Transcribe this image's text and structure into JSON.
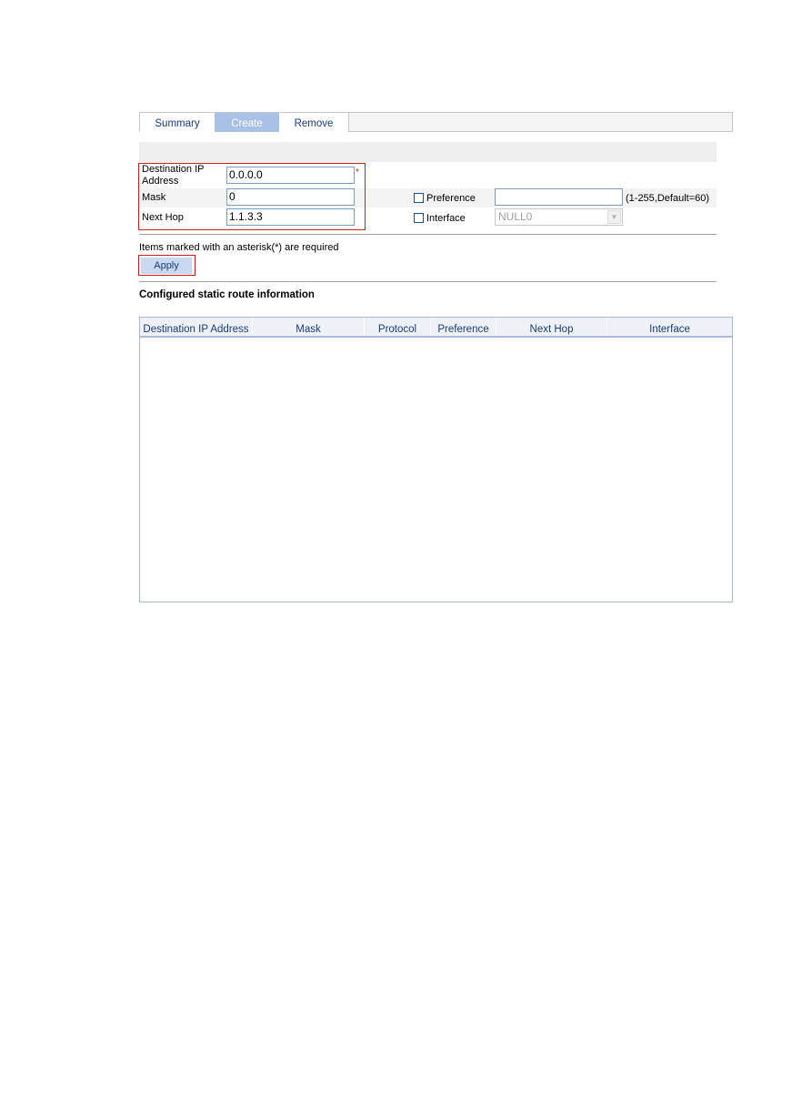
{
  "tabs": [
    {
      "label": "Summary",
      "active": false
    },
    {
      "label": "Create",
      "active": true
    },
    {
      "label": "Remove",
      "active": false
    }
  ],
  "form": {
    "dest_ip": {
      "label_line1": "Destination IP",
      "label_line2": "Address",
      "value": "0.0.0.0",
      "required_mark": "*"
    },
    "mask": {
      "label": "Mask",
      "value": "0"
    },
    "next_hop": {
      "label": "Next Hop",
      "value": "1.1.3.3"
    },
    "preference": {
      "label": "Preference",
      "checked": false,
      "value": "",
      "hint": "(1-255,Default=60)"
    },
    "interface": {
      "label": "Interface",
      "checked": false,
      "selected": "NULL0",
      "disabled": true
    }
  },
  "note": "Items marked with an asterisk(*) are required",
  "apply_label": "Apply",
  "section_title": "Configured static route information",
  "table": {
    "columns": [
      "Destination IP Address",
      "Mask",
      "Protocol",
      "Preference",
      "Next Hop",
      "Interface"
    ],
    "rows": []
  }
}
